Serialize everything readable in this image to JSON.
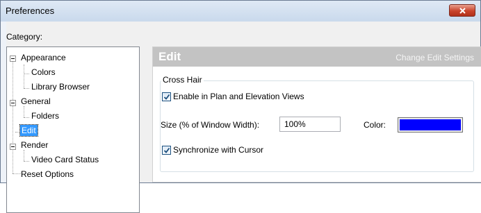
{
  "window": {
    "title": "Preferences"
  },
  "category_label": "Category:",
  "tree": {
    "appearance": "Appearance",
    "colors": "Colors",
    "library_browser": "Library Browser",
    "general": "General",
    "folders": "Folders",
    "edit": "Edit",
    "render": "Render",
    "video_card_status": "Video Card Status",
    "reset_options": "Reset Options"
  },
  "panel": {
    "title": "Edit",
    "subtitle": "Change Edit Settings",
    "group_label": "Cross Hair",
    "enable_label": "Enable in Plan and Elevation Views",
    "enable_checked": true,
    "size_label": "Size (% of Window Width):",
    "size_value": "100%",
    "color_label": "Color:",
    "color_value": "#0000ff",
    "sync_label": "Synchronize with Cursor",
    "sync_checked": true
  },
  "icons": {
    "close": "close-icon",
    "check": "checkmark-icon"
  }
}
